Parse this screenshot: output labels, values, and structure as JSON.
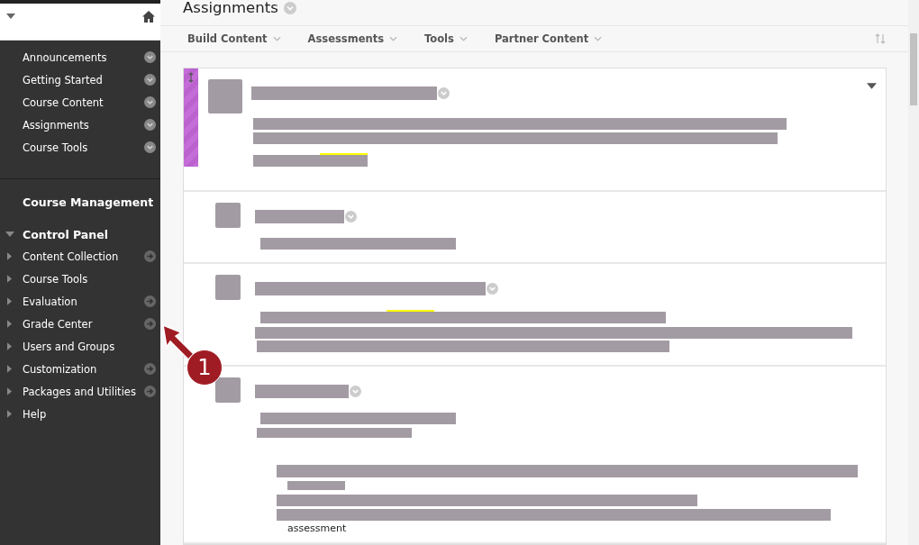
{
  "course_menu": {
    "expanded": true,
    "items": [
      {
        "label": "Announcements"
      },
      {
        "label": "Getting Started"
      },
      {
        "label": "Course Content"
      },
      {
        "label": "Assignments"
      },
      {
        "label": "Course Tools"
      }
    ]
  },
  "course_management": {
    "title": "Course Management",
    "control_panel": {
      "label": "Control Panel",
      "expanded": true
    },
    "items": [
      {
        "label": "Content Collection",
        "has_link": true
      },
      {
        "label": "Course Tools",
        "has_link": false
      },
      {
        "label": "Evaluation",
        "has_link": true
      },
      {
        "label": "Grade Center",
        "has_link": true
      },
      {
        "label": "Users and Groups",
        "has_link": false
      },
      {
        "label": "Customization",
        "has_link": true
      },
      {
        "label": "Packages and Utilities",
        "has_link": true
      },
      {
        "label": "Help",
        "has_link": false
      }
    ]
  },
  "page_title": "Assignments",
  "toolbar": [
    {
      "label": "Build Content"
    },
    {
      "label": "Assessments"
    },
    {
      "label": "Tools"
    },
    {
      "label": "Partner Content"
    }
  ],
  "content_items": [
    {
      "highlighted": true,
      "expanded": true
    },
    {
      "highlighted": false,
      "expanded": false
    },
    {
      "highlighted": false,
      "expanded": false
    },
    {
      "highlighted": false,
      "expanded": false,
      "footer_text": "assessment"
    }
  ],
  "annotation": {
    "label": "1"
  }
}
